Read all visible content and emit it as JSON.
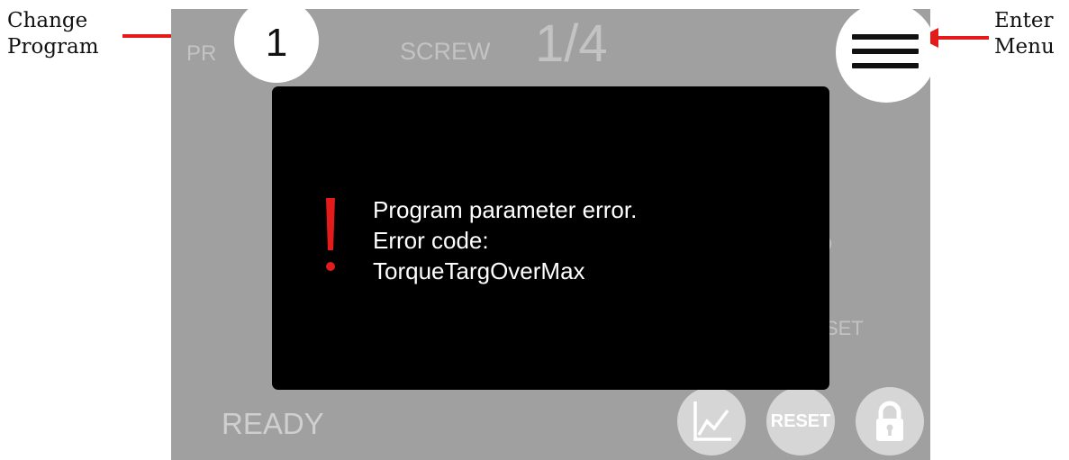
{
  "annotations": {
    "left": {
      "line1": "Change",
      "line2": "Program"
    },
    "right": {
      "line1": "Enter",
      "line2": "Menu"
    }
  },
  "header": {
    "program_label": "PR",
    "program_number": "1",
    "screw_label": "SCREW",
    "screw_count": "1/4"
  },
  "background_fragments": {
    "right_o": "O",
    "right_set": "SET"
  },
  "status": {
    "text": "READY"
  },
  "controls": {
    "reset_label": "RESET",
    "icons": [
      "graph-icon",
      "lock-icon",
      "menu-icon"
    ]
  },
  "dialog": {
    "icon": "exclamation-icon",
    "line1": "Program parameter error.",
    "line2": "Error code:",
    "line3": "TorqueTargOverMax"
  },
  "colors": {
    "screen_background": "#a0a0a0",
    "dialog_background": "#000000",
    "error_accent": "#e41b1b",
    "annotation_arrow": "#e41b1b"
  }
}
